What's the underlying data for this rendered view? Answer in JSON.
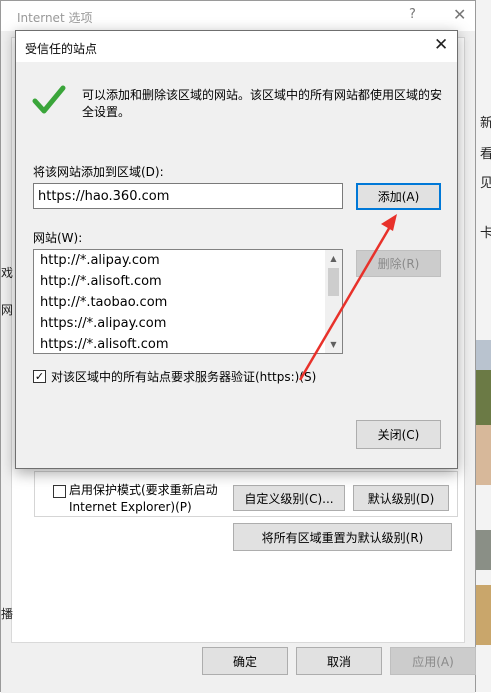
{
  "options_window": {
    "title": "Internet 选项",
    "help_icon": "?",
    "close_icon": "✕",
    "protected_mode_label": "启用保护模式(要求重新启动 Internet Explorer)(P)",
    "custom_level_button": "自定义级别(C)...",
    "default_level_button": "默认级别(D)",
    "reset_all_button": "将所有区域重置为默认级别(R)",
    "ok_button": "确定",
    "cancel_button": "取消",
    "apply_button": "应用(A)"
  },
  "dialog": {
    "title": "受信任的站点",
    "close_icon": "✕",
    "icon": "green-checkmark-icon",
    "description": "可以添加和删除该区域的网站。该区域中的所有网站都使用区域的安全设置。",
    "add_label": "将该网站添加到区域(D):",
    "url_value": "https://hao.360.com",
    "add_button": "添加(A)",
    "sites_label": "网站(W):",
    "sites": [
      "http://*.alipay.com",
      "http://*.alisoft.com",
      "http://*.taobao.com",
      "https://*.alipay.com",
      "https://*.alisoft.com"
    ],
    "remove_button": "删除(R)",
    "require_https_label": "对该区域中的所有站点要求服务器验证(https:)(S)",
    "require_https_checked": "✓",
    "close_button": "关闭(C)"
  },
  "background_fragments": {
    "right": [
      "新",
      "看",
      "见",
      "卡"
    ],
    "left": [
      "戏",
      "网",
      "播"
    ]
  },
  "colors": {
    "accent": "#0078d7",
    "check_green": "#3aa53a",
    "annotation_red": "#e8312a"
  }
}
